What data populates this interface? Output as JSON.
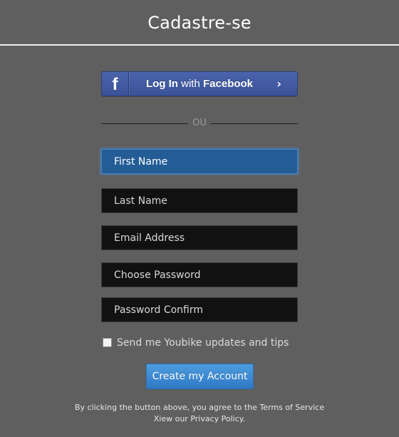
{
  "header": {
    "title": "Cadastre-se"
  },
  "facebook": {
    "icon_letter": "f",
    "icon": "facebook-f-icon",
    "label_login": "Log In",
    "label_with": "with",
    "label_brand": "Facebook",
    "chevron": "›",
    "color": "#3b5298"
  },
  "divider": {
    "text": "OU"
  },
  "form": {
    "first_name_placeholder": "First Name",
    "last_name_placeholder": "Last Name",
    "email_placeholder": "Email Address",
    "password_placeholder": "Choose Password",
    "password_confirm_placeholder": "Password Confirm",
    "focused_field_color": "#245d96"
  },
  "updates": {
    "label": "Send me Youbike updates and tips",
    "checked": false
  },
  "submit": {
    "label": "Create my Account",
    "color": "#3a88d4"
  },
  "legal": {
    "line1_prefix": "By clicking the button above, you agree to the ",
    "terms_link": "Terms of Service",
    "line2_prefix": "Xiew our ",
    "privacy_link": "Privacy Policy",
    "line2_suffix": "."
  },
  "colors": {
    "background": "#5f5f5f",
    "field_background": "#111111"
  }
}
